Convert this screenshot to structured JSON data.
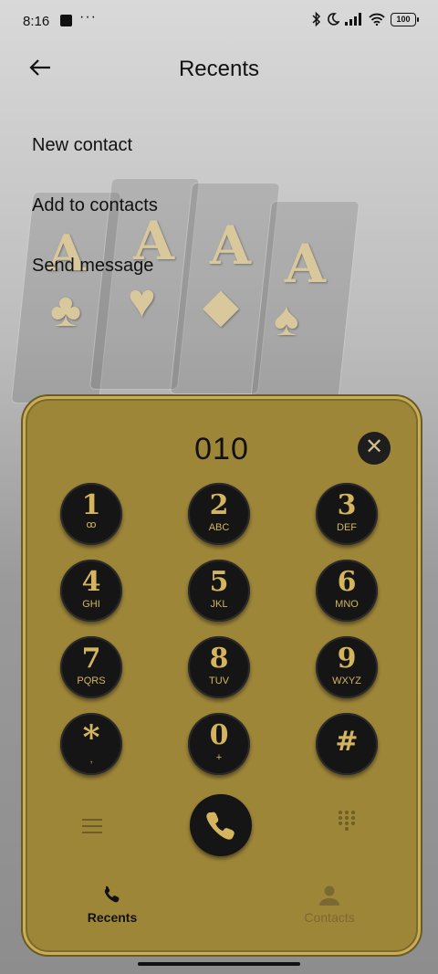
{
  "status": {
    "time": "8:16",
    "battery": "100"
  },
  "header": {
    "title": "Recents"
  },
  "menu": {
    "items": [
      "New contact",
      "Add to contacts",
      "Send message"
    ]
  },
  "decor": {
    "aces": [
      "A",
      "A",
      "A",
      "A"
    ],
    "suits": [
      "♣",
      "♥",
      "◆",
      "♠"
    ]
  },
  "dialer": {
    "number": "010",
    "keys": [
      {
        "digit": "1",
        "letters": "ꝏ"
      },
      {
        "digit": "2",
        "letters": "ABC"
      },
      {
        "digit": "3",
        "letters": "DEF"
      },
      {
        "digit": "4",
        "letters": "GHI"
      },
      {
        "digit": "5",
        "letters": "JKL"
      },
      {
        "digit": "6",
        "letters": "MNO"
      },
      {
        "digit": "7",
        "letters": "PQRS"
      },
      {
        "digit": "8",
        "letters": "TUV"
      },
      {
        "digit": "9",
        "letters": "WXYZ"
      },
      {
        "digit": "*",
        "letters": ","
      },
      {
        "digit": "0",
        "letters": "+"
      },
      {
        "digit": "#",
        "letters": ""
      }
    ]
  },
  "tabs": [
    {
      "label": "Recents",
      "icon": "phone-icon",
      "active": true
    },
    {
      "label": "Contacts",
      "icon": "person-icon",
      "active": false
    }
  ],
  "colors": {
    "panel": "#9e8639",
    "gold": "#d4b45c",
    "key": "#151515"
  }
}
